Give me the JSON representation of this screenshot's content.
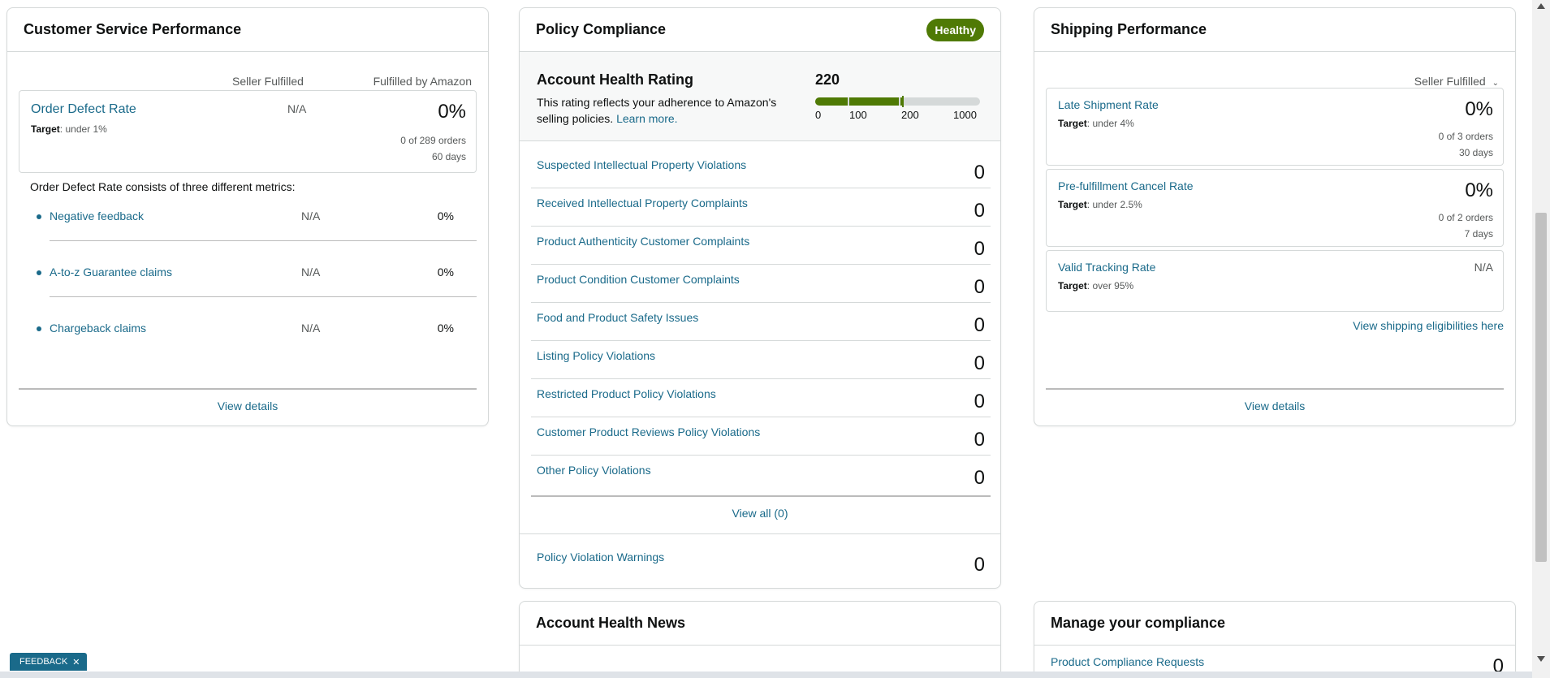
{
  "csp": {
    "title": "Customer Service Performance",
    "col_seller": "Seller Fulfilled",
    "col_fba": "Fulfilled by Amazon",
    "odr": {
      "title": "Order Defect Rate",
      "target_label": "Target",
      "target_value": ": under 1%",
      "seller_value": "N/A",
      "pct": "0%",
      "orders": "0 of 289 orders",
      "days": "60 days"
    },
    "description": "Order Defect Rate consists of three different metrics:",
    "metrics": [
      {
        "label": "Negative feedback",
        "seller": "N/A",
        "fba": "0%"
      },
      {
        "label": "A-to-z Guarantee claims",
        "seller": "N/A",
        "fba": "0%"
      },
      {
        "label": "Chargeback claims",
        "seller": "N/A",
        "fba": "0%"
      }
    ],
    "view_details": "View details"
  },
  "pc": {
    "title": "Policy Compliance",
    "badge": "Healthy",
    "ahr": {
      "title": "Account Health Rating",
      "desc": "This rating reflects your adherence to Amazon's selling policies.",
      "learn_more": "Learn more.",
      "score": "220",
      "score_value": 220,
      "ticks": [
        "0",
        "100",
        "200",
        "1000"
      ]
    },
    "violations": [
      {
        "label": "Suspected Intellectual Property Violations",
        "count": "0"
      },
      {
        "label": "Received Intellectual Property Complaints",
        "count": "0"
      },
      {
        "label": "Product Authenticity Customer Complaints",
        "count": "0"
      },
      {
        "label": "Product Condition Customer Complaints",
        "count": "0"
      },
      {
        "label": "Food and Product Safety Issues",
        "count": "0"
      },
      {
        "label": "Listing Policy Violations",
        "count": "0"
      },
      {
        "label": "Restricted Product Policy Violations",
        "count": "0"
      },
      {
        "label": "Customer Product Reviews Policy Violations",
        "count": "0"
      },
      {
        "label": "Other Policy Violations",
        "count": "0"
      }
    ],
    "view_all": "View all (0)",
    "warnings": {
      "label": "Policy Violation Warnings",
      "count": "0"
    }
  },
  "sp": {
    "title": "Shipping Performance",
    "filter": "Seller Fulfilled",
    "metrics": [
      {
        "title": "Late Shipment Rate",
        "target_label": "Target",
        "target_value": ": under 4%",
        "pct": "0%",
        "orders": "0 of 3 orders",
        "days": "30 days"
      },
      {
        "title": "Pre-fulfillment Cancel Rate",
        "target_label": "Target",
        "target_value": ": under 2.5%",
        "pct": "0%",
        "orders": "0 of 2 orders",
        "days": "7 days"
      }
    ],
    "valid_tracking": {
      "title": "Valid Tracking Rate",
      "target_label": "Target",
      "target_value": ": over 95%",
      "value": "N/A"
    },
    "eligibility_link": "View shipping eligibilities here",
    "view_details": "View details"
  },
  "news": {
    "title": "Account Health News"
  },
  "manage": {
    "title": "Manage your compliance",
    "item_label": "Product Compliance Requests",
    "item_count": "0"
  },
  "feedback": {
    "label": "FEEDBACK",
    "close": "✕"
  },
  "colors": {
    "accent_link": "#1a6a8a",
    "healthy_green": "#4f7a05",
    "border": "#d5d9d9"
  }
}
